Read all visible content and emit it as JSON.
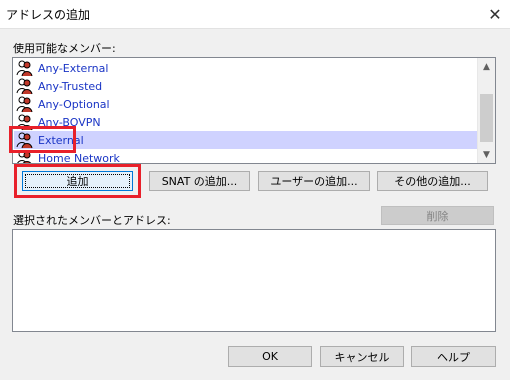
{
  "window": {
    "title": "アドレスの追加"
  },
  "available": {
    "label": "使用可能なメンバー:",
    "items": [
      {
        "label": "Any-External"
      },
      {
        "label": "Any-Trusted"
      },
      {
        "label": "Any-Optional"
      },
      {
        "label": "Any-BOVPN"
      },
      {
        "label": "External",
        "selected": true
      },
      {
        "label": "Home Network"
      }
    ]
  },
  "buttons": {
    "add": "追加",
    "add_snat": "SNAT の追加...",
    "add_user": "ユーザーの追加...",
    "add_other": "その他の追加...",
    "remove": "削除",
    "ok": "OK",
    "cancel": "キャンセル",
    "help": "ヘルプ"
  },
  "selected_members": {
    "label": "選択されたメンバーとアドレス:"
  },
  "colors": {
    "highlight": "#e8202a",
    "selection": "#cfd2ff",
    "link": "#1a35c5"
  }
}
